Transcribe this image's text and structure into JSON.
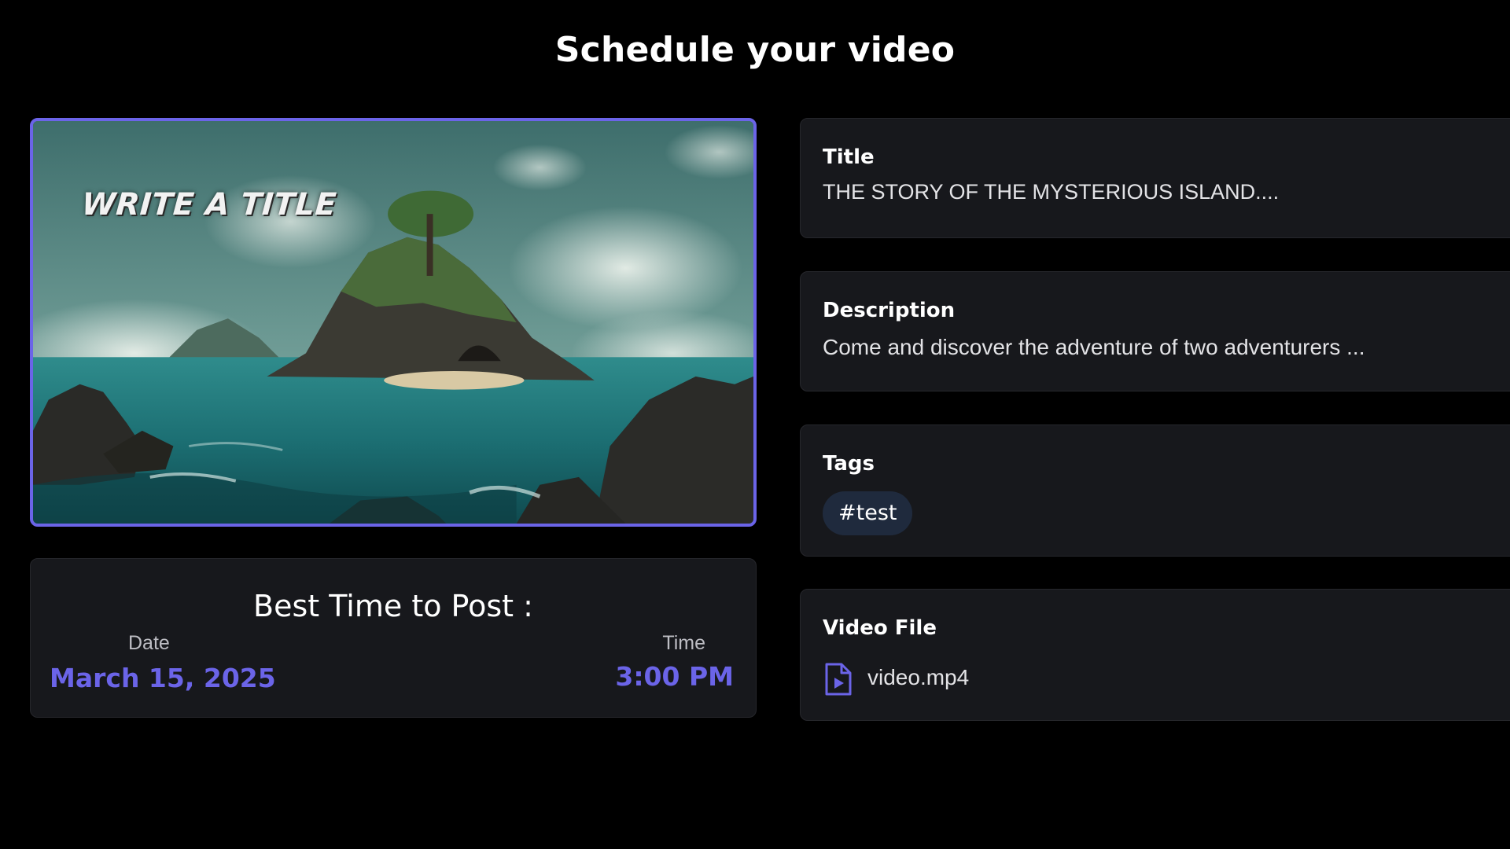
{
  "page": {
    "title": "Schedule your video"
  },
  "thumbnail": {
    "overlay_text": "WRITE A TITLE",
    "border_color": "#6b64e8"
  },
  "best_time": {
    "heading": "Best Time to Post :",
    "date_label": "Date",
    "date_value": "March 15, 2025",
    "time_label": "Time",
    "time_value": "3:00 PM",
    "accent_color": "#6b64e8"
  },
  "fields": {
    "title": {
      "label": "Title",
      "value": "THE STORY OF THE MYSTERIOUS ISLAND...."
    },
    "description": {
      "label": "Description",
      "value": "Come and discover the adventure of two adventurers ..."
    },
    "tags": {
      "label": "Tags",
      "items": [
        "#test"
      ]
    },
    "video_file": {
      "label": "Video File",
      "file_name": "video.mp4",
      "icon": "video-file-icon"
    }
  }
}
